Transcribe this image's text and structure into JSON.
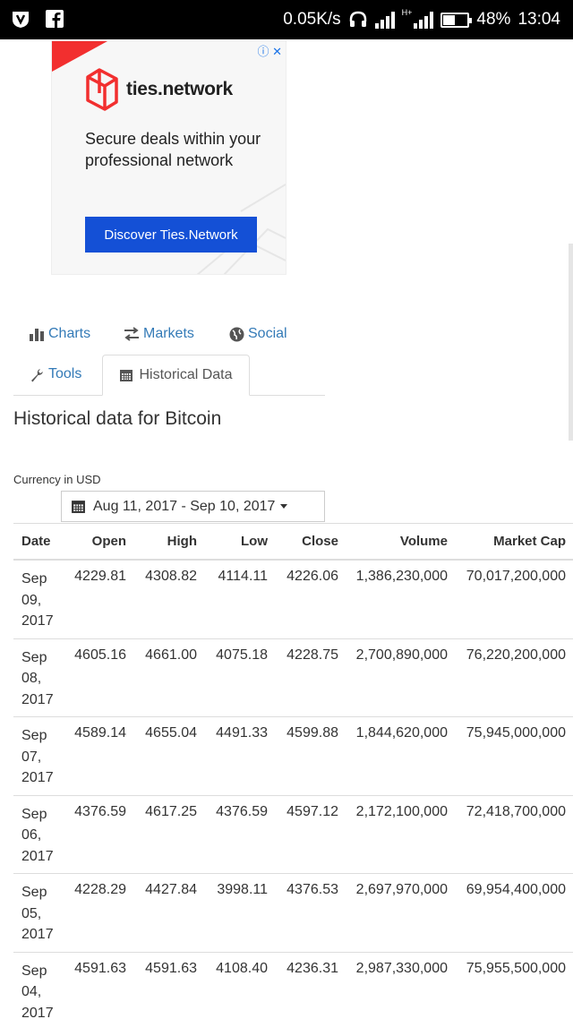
{
  "status_bar": {
    "speed": "0.05K/s",
    "network_label": "H+",
    "battery": "48%",
    "battery_level": 0.48,
    "time": "13:04"
  },
  "ad": {
    "info_glyph": "ⓘ",
    "close_glyph": "✕",
    "brand": "ties.network",
    "text": "Secure deals within your professional network",
    "button": "Discover Ties.Network",
    "accent": "#f22f2f",
    "button_color": "#1450d6"
  },
  "tabs": {
    "charts": "Charts",
    "markets": "Markets",
    "social": "Social",
    "tools": "Tools",
    "historical": "Historical Data"
  },
  "page": {
    "title": "Historical data for Bitcoin",
    "currency": "Currency in USD",
    "date_range": "Aug 11, 2017 - Sep 10, 2017"
  },
  "table": {
    "headers": [
      "Date",
      "Open",
      "High",
      "Low",
      "Close",
      "Volume",
      "Market Cap"
    ],
    "rows": [
      {
        "date": "Sep 09, 2017",
        "open": "4229.81",
        "high": "4308.82",
        "low": "4114.11",
        "close": "4226.06",
        "volume": "1,386,230,000",
        "cap": "70,017,200,000"
      },
      {
        "date": "Sep 08, 2017",
        "open": "4605.16",
        "high": "4661.00",
        "low": "4075.18",
        "close": "4228.75",
        "volume": "2,700,890,000",
        "cap": "76,220,200,000"
      },
      {
        "date": "Sep 07, 2017",
        "open": "4589.14",
        "high": "4655.04",
        "low": "4491.33",
        "close": "4599.88",
        "volume": "1,844,620,000",
        "cap": "75,945,000,000"
      },
      {
        "date": "Sep 06, 2017",
        "open": "4376.59",
        "high": "4617.25",
        "low": "4376.59",
        "close": "4597.12",
        "volume": "2,172,100,000",
        "cap": "72,418,700,000"
      },
      {
        "date": "Sep 05, 2017",
        "open": "4228.29",
        "high": "4427.84",
        "low": "3998.11",
        "close": "4376.53",
        "volume": "2,697,970,000",
        "cap": "69,954,400,000"
      },
      {
        "date": "Sep 04, 2017",
        "open": "4591.63",
        "high": "4591.63",
        "low": "4108.40",
        "close": "4236.31",
        "volume": "2,987,330,000",
        "cap": "75,955,500,000"
      }
    ]
  }
}
